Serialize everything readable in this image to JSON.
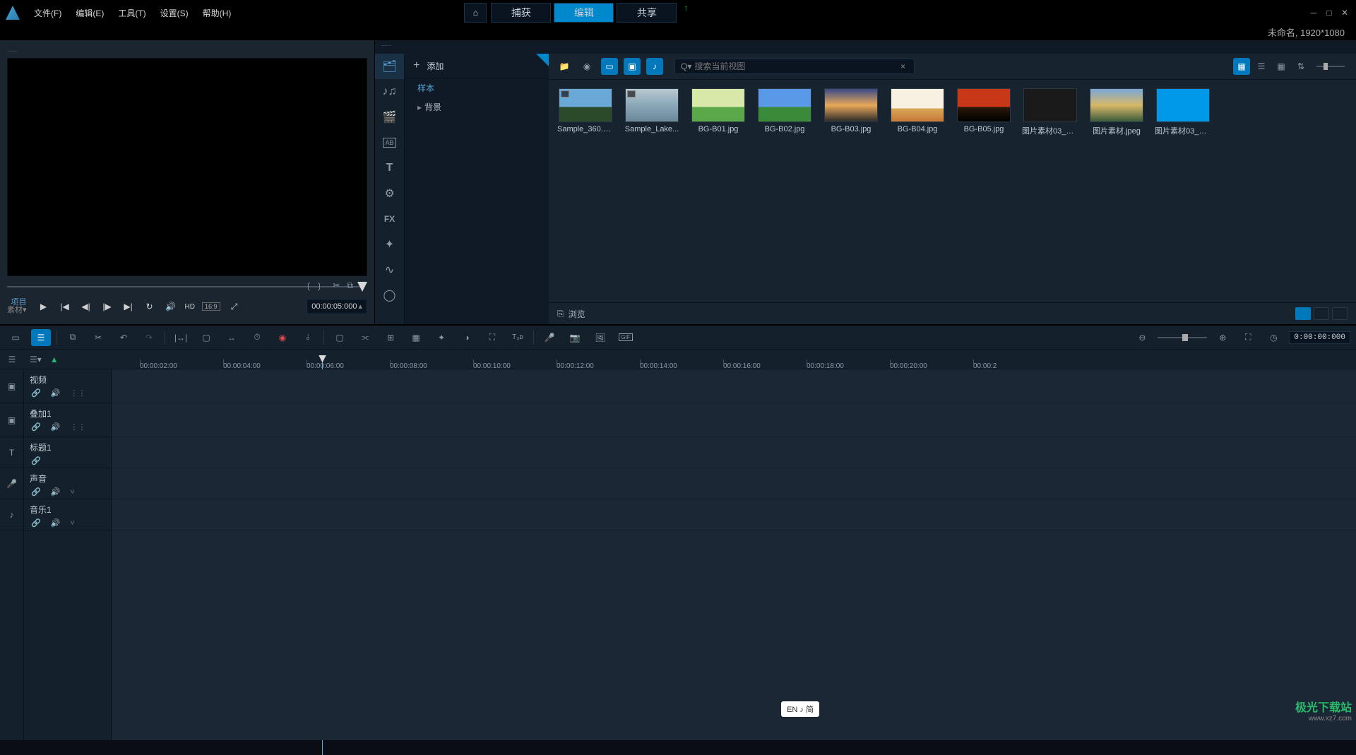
{
  "menubar": {
    "items": [
      "文件(F)",
      "编辑(E)",
      "工具(T)",
      "设置(S)",
      "帮助(H)"
    ]
  },
  "top_tabs": {
    "home_icon": "⌂",
    "items": [
      "捕获",
      "编辑",
      "共享"
    ],
    "active_index": 1
  },
  "window": {
    "status": "未命名, 1920*1080"
  },
  "player": {
    "proj_label": "项目",
    "material_label": "素材",
    "hd": "HD",
    "aspect": "16:9",
    "timecode": "00:00:05:000"
  },
  "library": {
    "add_label": "添加",
    "tree": {
      "sample": "样本",
      "background": "背景"
    },
    "search_placeholder": "搜索当前视图",
    "browse_label": "浏览",
    "fx_label": "FX",
    "thumbs": [
      {
        "name": "sample-360",
        "label": "Sample_360.m...",
        "bg": "linear-gradient(180deg,#6aa8d8 0%,#6aa8d8 55%,#2a4a2a 55%,#2a4a2a 100%)",
        "video": true
      },
      {
        "name": "sample-lake",
        "label": "Sample_Lake...",
        "bg": "linear-gradient(180deg,#b8c8d0 0%,#8aa8b8 50%,#6a8898 100%)",
        "video": true
      },
      {
        "name": "bg-b01",
        "label": "BG-B01.jpg",
        "bg": "linear-gradient(180deg,#d8e8a8 0%,#d8e8a8 55%,#5aa84a 55%,#5aa84a 100%)"
      },
      {
        "name": "bg-b02",
        "label": "BG-B02.jpg",
        "bg": "linear-gradient(180deg,#5a98e8 0%,#5a98e8 55%,#3a8a3a 55%,#3a8a3a 100%)"
      },
      {
        "name": "bg-b03",
        "label": "BG-B03.jpg",
        "bg": "linear-gradient(180deg,#3a4a88 0%,#e8a858 50%,#2a2a2a 100%)"
      },
      {
        "name": "bg-b04",
        "label": "BG-B04.jpg",
        "bg": "linear-gradient(180deg,#f8f0e0 0%,#f8f0e0 60%,#d8a858 60%,#c87838 100%)"
      },
      {
        "name": "bg-b05",
        "label": "BG-B05.jpg",
        "bg": "linear-gradient(180deg,#c83818 0%,#c83818 55%,#2a1a0a 55%,#000 100%)"
      },
      {
        "name": "pic-03-copy",
        "label": "图片素材03_副...",
        "bg": "#1a1a1a"
      },
      {
        "name": "pic-material",
        "label": "图片素材.jpeg",
        "bg": "linear-gradient(180deg,#7aa8d8 0%,#d8b868 50%,#3a5a3a 100%)"
      },
      {
        "name": "pic-03-copy2",
        "label": "图片素材03_副...",
        "bg": "#0098e8"
      }
    ]
  },
  "timeline": {
    "timecode": "0:00:00:000",
    "ruler": [
      "00:00:02:00",
      "00:00:04:00",
      "00:00:06:00",
      "00:00:08:00",
      "00:00:10:00",
      "00:00:12:00",
      "00:00:14:00",
      "00:00:16:00",
      "00:00:18:00",
      "00:00:20:00",
      "00:00:2"
    ],
    "tracks": [
      {
        "name": "视频",
        "type": "video",
        "icons": [
          "link",
          "sound",
          "grid"
        ]
      },
      {
        "name": "叠加1",
        "type": "video",
        "icons": [
          "link",
          "sound",
          "grid"
        ]
      },
      {
        "name": "标题1",
        "type": "text",
        "icons": [
          "link"
        ]
      },
      {
        "name": "声音",
        "type": "audio",
        "icons": [
          "link",
          "sound",
          "expand"
        ]
      },
      {
        "name": "音乐1",
        "type": "music",
        "icons": [
          "link",
          "sound",
          "expand"
        ]
      }
    ]
  },
  "ime": "EN ♪ 简",
  "watermark": {
    "brand": "极光下载站",
    "url": "www.xz7.com"
  }
}
